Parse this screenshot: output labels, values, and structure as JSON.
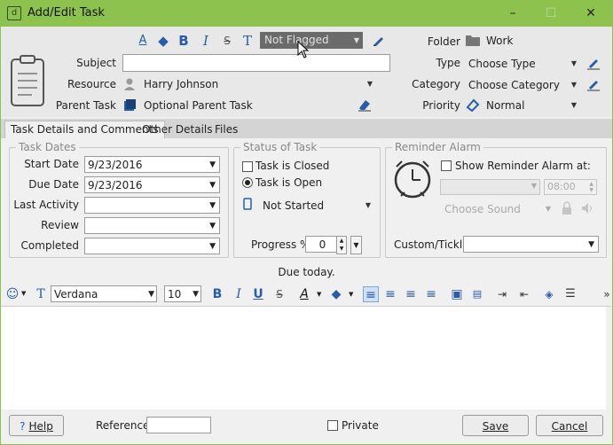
{
  "window": {
    "title": "Add/Edit Task",
    "minimize": "–",
    "maximize": "☐",
    "close": "✕"
  },
  "header": {
    "flag": "Not Flagged",
    "subject_label": "Subject",
    "subject_value": "",
    "resource_label": "Resource",
    "resource_value": "Harry Johnson",
    "parent_task_label": "Parent Task",
    "parent_task_value": "Optional Parent Task",
    "folder_label": "Folder",
    "folder_value": "Work",
    "type_label": "Type",
    "type_value": "Choose Type",
    "category_label": "Category",
    "category_value": "Choose Category",
    "priority_label": "Priority",
    "priority_value": "Normal"
  },
  "tabs": [
    {
      "label": "Task Details and Comments"
    },
    {
      "label": "Other Details"
    },
    {
      "label": "Files"
    }
  ],
  "task_dates": {
    "title": "Task Dates",
    "start_label": "Start Date",
    "start_value": "9/23/2016",
    "due_label": "Due Date",
    "due_value": "9/23/2016",
    "last_activity_label": "Last Activity",
    "last_activity_value": "",
    "review_label": "Review",
    "review_value": "",
    "completed_label": "Completed",
    "completed_value": ""
  },
  "status": {
    "title": "Status of Task",
    "closed_label": "Task is Closed",
    "open_label": "Task is Open",
    "progress_state": "Not Started",
    "progress_label": "Progress %",
    "progress_value": "0"
  },
  "reminder": {
    "title": "Reminder Alarm",
    "show_label": "Show Reminder Alarm at:",
    "date_value": "",
    "time_value": "08:00",
    "sound_label": "Choose Sound",
    "custom_label": "Custom/Tickle",
    "custom_value": ""
  },
  "due_message": "Due today.",
  "format": {
    "font": "Verdana",
    "size": "10",
    "bold": "B",
    "italic": "I",
    "underline": "U",
    "strike": "S",
    "more": "»"
  },
  "footer": {
    "help": "Help",
    "reference_label": "Reference",
    "reference_value": "",
    "private_label": "Private",
    "save": "Save",
    "cancel": "Cancel"
  },
  "colors": {
    "titlebar": "#8ec24f",
    "accent_blue": "#2a5ca8",
    "flag_bg": "#6b6b6b"
  }
}
